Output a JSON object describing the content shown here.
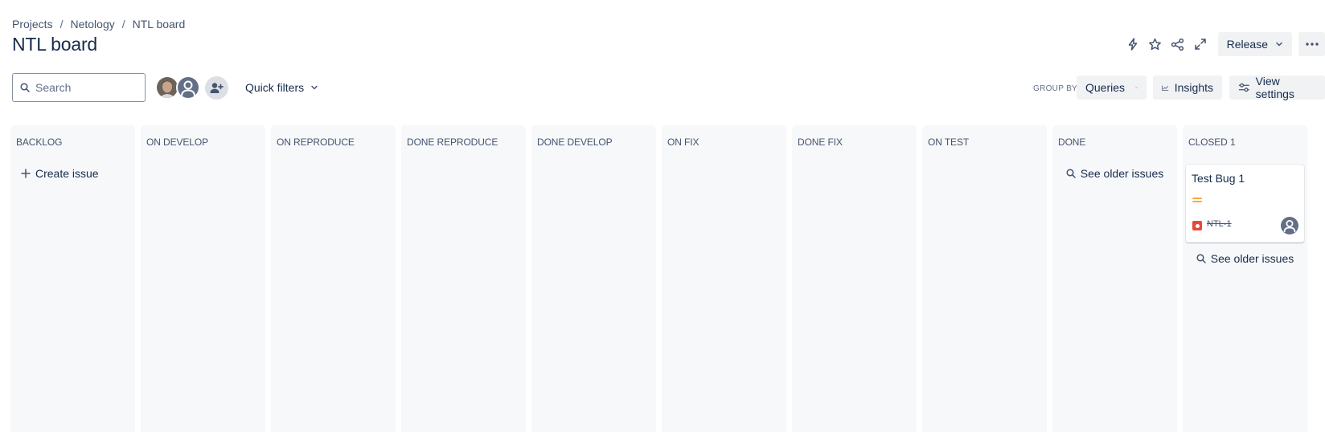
{
  "breadcrumb": {
    "items": [
      "Projects",
      "Netology",
      "NTL board"
    ],
    "separator": "/"
  },
  "page": {
    "title": "NTL board"
  },
  "toolbar": {
    "actions": [
      "lightning-icon",
      "star-icon",
      "share-icon",
      "expand-icon"
    ],
    "release_label": "Release",
    "more_icon": "ellipsis-icon"
  },
  "search": {
    "placeholder": "Search",
    "value": ""
  },
  "filters": {
    "avatars": [
      "user-photo",
      "default-user"
    ],
    "add_people_icon": "add-person-icon",
    "quick_filters_label": "Quick filters",
    "group_by_label": "GROUP BY",
    "group_by_value": "Queries",
    "insights_label": "Insights",
    "view_settings_label": "View settings"
  },
  "columns": [
    {
      "title": "BACKLOG",
      "action": "Create issue"
    },
    {
      "title": "ON DEVELOP"
    },
    {
      "title": "ON REPRODUCE"
    },
    {
      "title": "DONE REPRODUCE"
    },
    {
      "title": "DONE DEVELOP"
    },
    {
      "title": "ON FIX"
    },
    {
      "title": "DONE FIX"
    },
    {
      "title": "ON TEST"
    },
    {
      "title": "DONE",
      "action": "See older issues"
    },
    {
      "title": "CLOSED 1",
      "action": "See older issues"
    }
  ],
  "card": {
    "summary": "Test Bug 1",
    "priority": "medium",
    "issue_type": "bug",
    "key": "NTL-1",
    "resolved": true
  },
  "colors": {
    "text": "#172b4d",
    "subtle_text": "#44546f",
    "column_bg": "#f7f8f9",
    "button_bg": "#f1f2f4",
    "priority_medium": "#ff991f",
    "bug": "#e5493a"
  }
}
